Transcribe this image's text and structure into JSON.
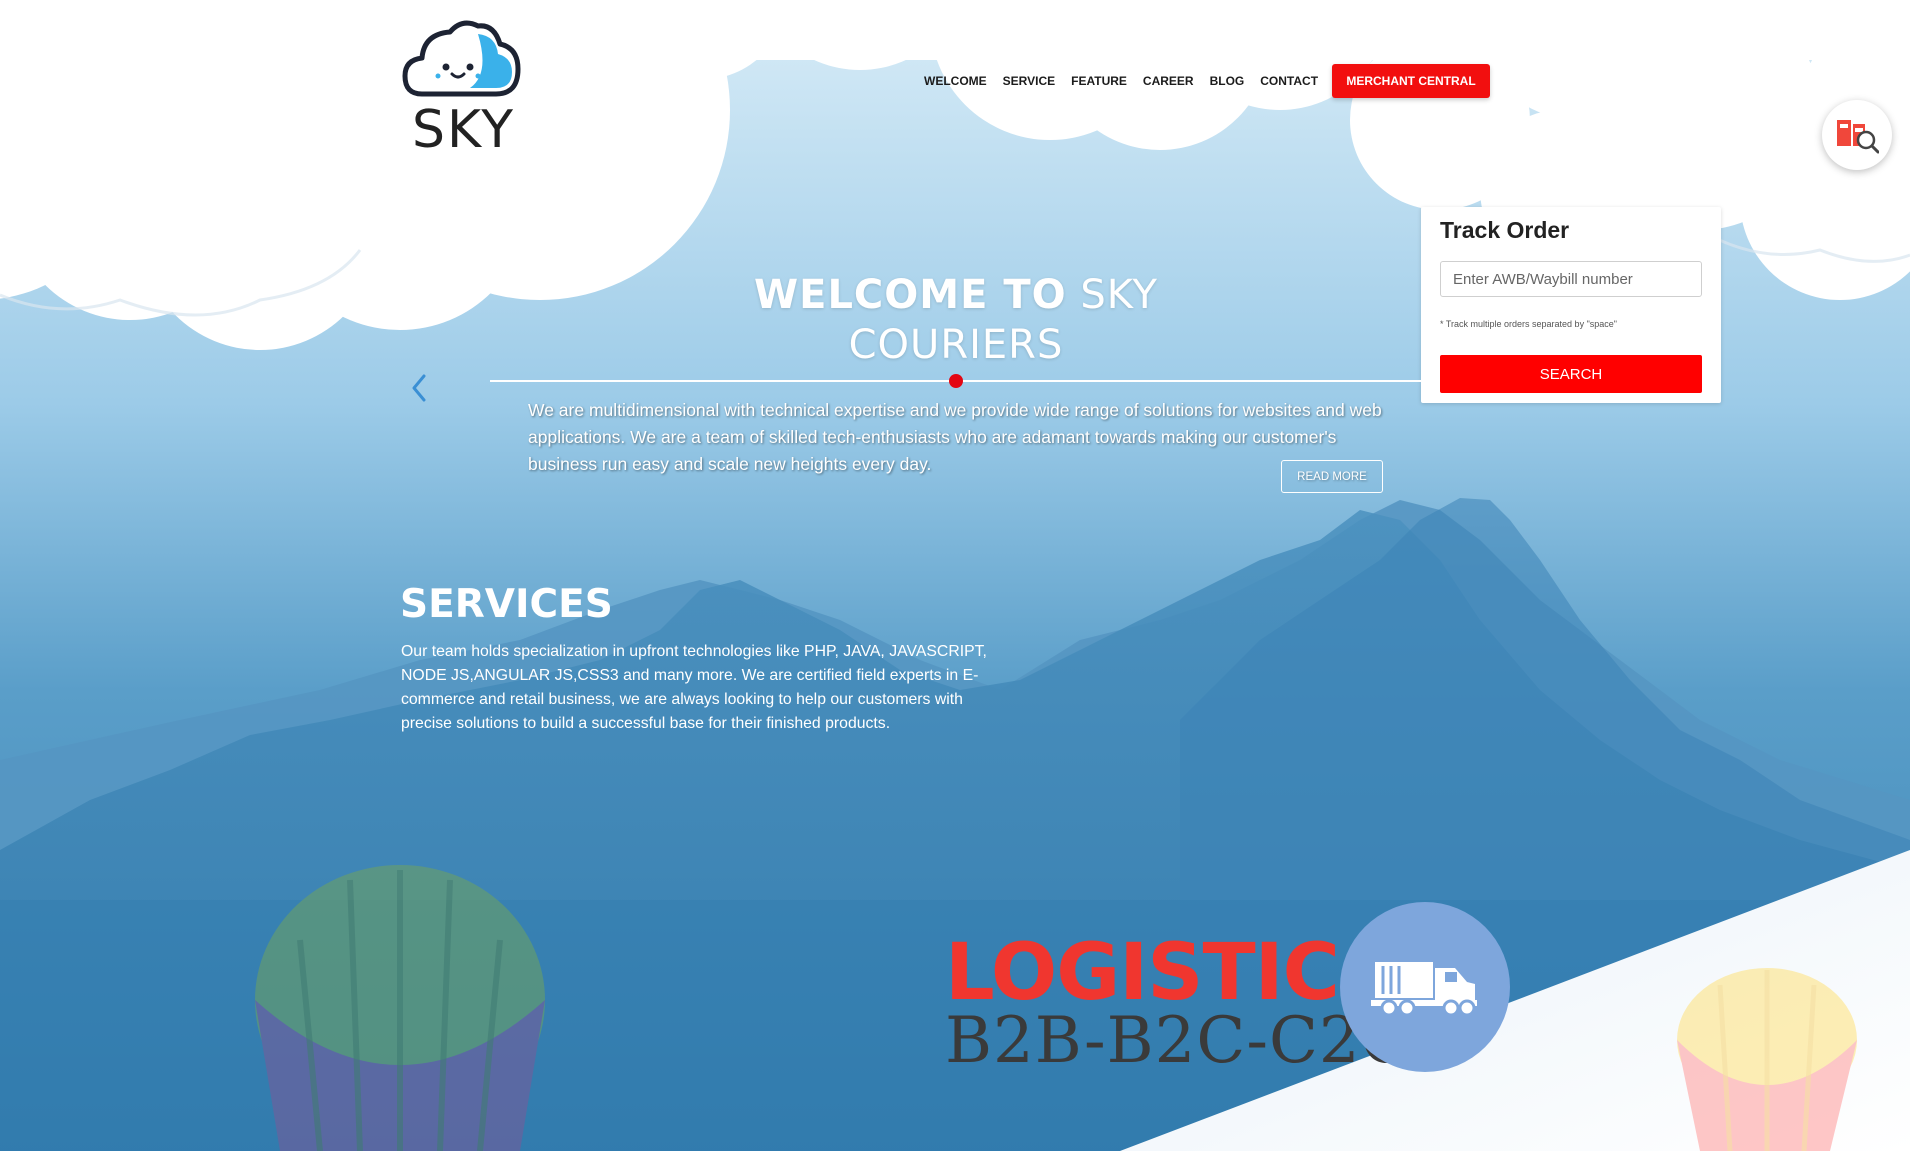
{
  "brand": {
    "name": "SKY"
  },
  "nav": {
    "items": [
      {
        "label": "WELCOME"
      },
      {
        "label": "SERVICE"
      },
      {
        "label": "FEATURE"
      },
      {
        "label": "CAREER"
      },
      {
        "label": "BLOG"
      },
      {
        "label": "CONTACT"
      }
    ],
    "merchant_label": "MERCHANT CENTRAL"
  },
  "track": {
    "title": "Track Order",
    "placeholder": "Enter AWB/Waybill number",
    "hint": "* Track multiple orders separated by \"space\"",
    "search_label": "SEARCH"
  },
  "hero": {
    "title_bold": "WELCOME TO",
    "title_light_1": "SKY",
    "title_light_2": "COURIERS",
    "text": "We are multidimensional with technical expertise and we provide wide range of solutions for websites and web applications. We are a team of skilled tech-enthusiasts who are adamant towards making our customer's business run easy and scale new heights every day.",
    "read_more_label": "READ MORE"
  },
  "services": {
    "heading": "SERVICES",
    "text": "Our team holds specialization in upfront technologies like PHP, JAVA, JAVASCRIPT, NODE JS,ANGULAR JS,CSS3 and many more. We are certified field experts in E-commerce and retail business, we are always looking to help our customers with precise solutions to build a successful base for their finished products."
  },
  "logistic": {
    "title": "LOGISTIC",
    "subtitle": "B2B-B2C-C2C"
  },
  "colors": {
    "accent": "#f20f0f",
    "sky_top": "#cfe6f4",
    "mountain": "#2f7db0",
    "logistic_red": "#f0362f",
    "truck_circle": "#7ea6dc"
  },
  "icons": {
    "prev": "chevron-left-icon",
    "truck": "truck-icon",
    "float_tool": "package-search-icon",
    "logo": "cloud-face-icon"
  }
}
